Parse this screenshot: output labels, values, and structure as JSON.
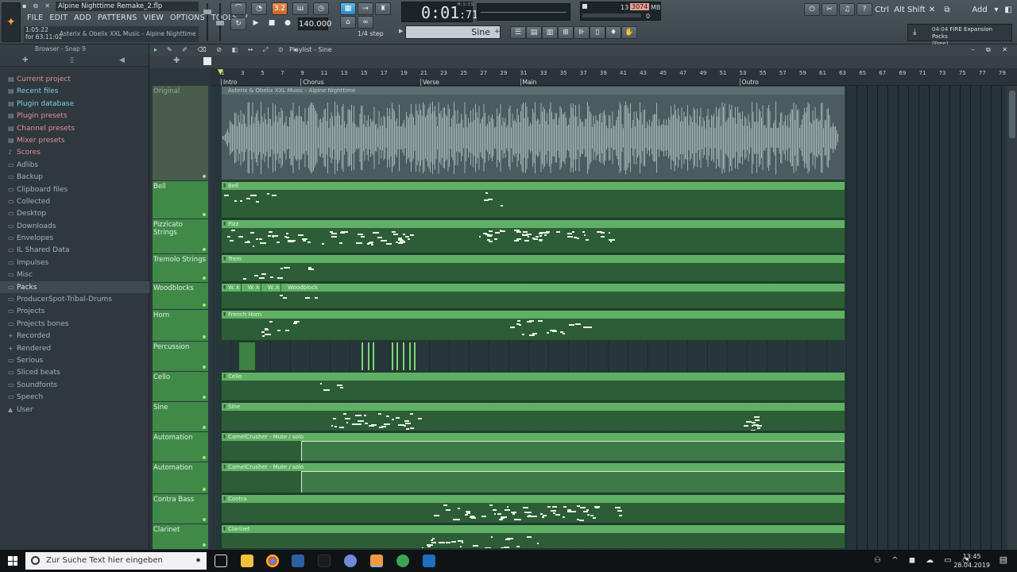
{
  "window": {
    "file_title": "Alpine Nighttime Remake_2.flp",
    "hint_time": "1:05:22",
    "hint_for": "for 63:11:02",
    "hint_text": "Asterix & Obelix XXL Music - Alpine Nighttime"
  },
  "menu": [
    "FILE",
    "EDIT",
    "ADD",
    "PATTERNS",
    "VIEW",
    "OPTIONS",
    "TOOLS",
    "?"
  ],
  "transport": {
    "pat_song_label": "3.2",
    "tempo": "140.000",
    "time_main": "0:01",
    "time_sub": ":71",
    "time_unit": "M:S:CS",
    "snap": "1/4 step",
    "pattern_name": "Sine"
  },
  "cpu": {
    "voices": "13",
    "memory": "3074",
    "memory_unit": "MB",
    "zero": "0"
  },
  "keys": [
    "Ctrl",
    "Alt",
    "Shift",
    "Add"
  ],
  "news": {
    "time": "04:04",
    "title": "FIRE Expansion Packs",
    "sub": "(Free)"
  },
  "browser": {
    "title": "Browser - Snap 9",
    "items": [
      {
        "label": "Current project",
        "style": "hl",
        "icon": "▤"
      },
      {
        "label": "Recent files",
        "style": "cy",
        "icon": "▤"
      },
      {
        "label": "Plugin database",
        "style": "cy",
        "icon": "▤"
      },
      {
        "label": "Plugin presets",
        "style": "hl",
        "icon": "▤"
      },
      {
        "label": "Channel presets",
        "style": "hl",
        "icon": "▤"
      },
      {
        "label": "Mixer presets",
        "style": "hl",
        "icon": "▤"
      },
      {
        "label": "Scores",
        "style": "hl",
        "icon": "♪"
      },
      {
        "label": "Adlibs",
        "style": "",
        "icon": "▭"
      },
      {
        "label": "Backup",
        "style": "",
        "icon": "▭"
      },
      {
        "label": "Clipboard files",
        "style": "",
        "icon": "▭"
      },
      {
        "label": "Collected",
        "style": "",
        "icon": "▭"
      },
      {
        "label": "Desktop",
        "style": "",
        "icon": "▭"
      },
      {
        "label": "Downloads",
        "style": "",
        "icon": "▭"
      },
      {
        "label": "Envelopes",
        "style": "",
        "icon": "▭"
      },
      {
        "label": "IL Shared Data",
        "style": "",
        "icon": "▭"
      },
      {
        "label": "Impulses",
        "style": "",
        "icon": "▭"
      },
      {
        "label": "Misc",
        "style": "",
        "icon": "▭"
      },
      {
        "label": "Packs",
        "style": "sel",
        "icon": "▭"
      },
      {
        "label": "ProducerSpot-Tribal-Drums",
        "style": "",
        "icon": "▭"
      },
      {
        "label": "Projects",
        "style": "",
        "icon": "▭"
      },
      {
        "label": "Projects bones",
        "style": "",
        "icon": "▭"
      },
      {
        "label": "Recorded",
        "style": "",
        "icon": "+"
      },
      {
        "label": "Rendered",
        "style": "",
        "icon": "+"
      },
      {
        "label": "Serious",
        "style": "",
        "icon": "▭"
      },
      {
        "label": "Sliced beats",
        "style": "",
        "icon": "▭"
      },
      {
        "label": "Soundfonts",
        "style": "",
        "icon": "▭"
      },
      {
        "label": "Speech",
        "style": "",
        "icon": "▭"
      },
      {
        "label": "User",
        "style": "",
        "icon": "▲"
      }
    ]
  },
  "playlist": {
    "title": "Playlist - Sine",
    "bar_numbers": [
      "1",
      "3",
      "5",
      "7",
      "9",
      "11",
      "13",
      "15",
      "17",
      "19",
      "21",
      "23",
      "25",
      "27",
      "29",
      "31",
      "33",
      "35",
      "37",
      "39",
      "41",
      "43",
      "45",
      "47",
      "49",
      "51",
      "53",
      "55",
      "57",
      "59",
      "61",
      "63",
      "65",
      "67",
      "69",
      "71",
      "73",
      "75",
      "77",
      "79"
    ],
    "markers": [
      {
        "label": "Intro",
        "bar": 1
      },
      {
        "label": "Chorus",
        "bar": 9
      },
      {
        "label": "Verse",
        "bar": 21
      },
      {
        "label": "Main",
        "bar": 31
      },
      {
        "label": "Outro",
        "bar": 53
      }
    ],
    "tracks": [
      {
        "name": "Original",
        "clip": "Asterix & Obelix XXL Music - Alpine Nighttime",
        "kind": "audio"
      },
      {
        "name": "Bell",
        "clip": "Bell",
        "kind": "notes"
      },
      {
        "name": "Pizzicato Strings",
        "clip": "Pizz",
        "kind": "notes"
      },
      {
        "name": "Tremolo Strings",
        "clip": "Trem",
        "kind": "notes"
      },
      {
        "name": "Woodblocks",
        "clip": "Woodblock",
        "kind": "notes"
      },
      {
        "name": "Horn",
        "clip": "French Horn",
        "kind": "notes"
      },
      {
        "name": "Percussion",
        "clip": "",
        "kind": "perc"
      },
      {
        "name": "Cello",
        "clip": "Cello",
        "kind": "notes"
      },
      {
        "name": "Sine",
        "clip": "Sine",
        "kind": "notes"
      },
      {
        "name": "Automation",
        "clip": "CamelCrusher - Mute / solo",
        "kind": "auto"
      },
      {
        "name": "Automation",
        "clip": "CamelCrusher - Mute / solo",
        "kind": "auto"
      },
      {
        "name": "Contra Bass",
        "clip": "Contra",
        "kind": "notes"
      },
      {
        "name": "Clarinet",
        "clip": "Clarinet",
        "kind": "notes"
      }
    ],
    "woodblock_labels": [
      "W..k",
      "W..k",
      "W..k"
    ]
  },
  "taskbar": {
    "search_placeholder": "Zur Suche Text hier eingeben",
    "time": "13:45",
    "date": "28.04.2019"
  }
}
